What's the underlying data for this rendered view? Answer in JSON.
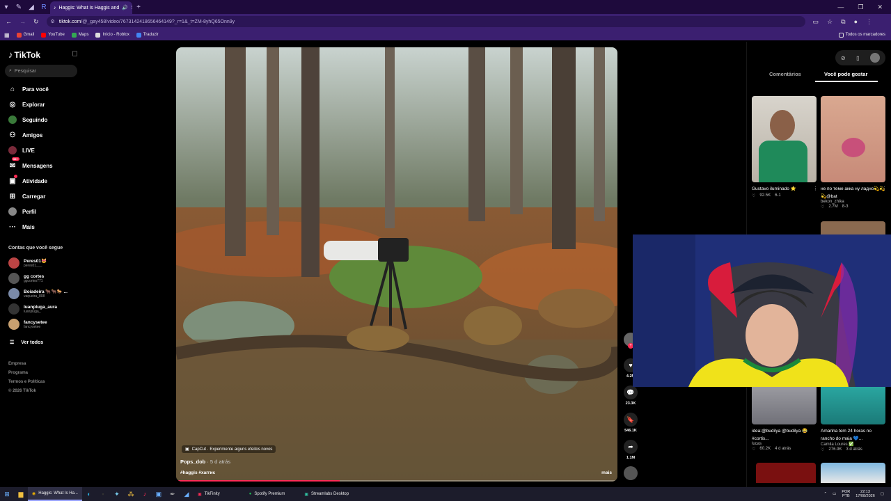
{
  "browser": {
    "tab_title": "Haggis: What Is Haggis and",
    "url_host": "tiktok.com",
    "url_path": "/@_gay458/video/7673142418656464149?_r=1&_t=ZM-8yhQ65Onn9y",
    "bookmarks": [
      "Gmail",
      "YouTube",
      "Maps",
      "Início - Roblox",
      "Traduzir"
    ],
    "all_bookmarks": "Todos os marcadores"
  },
  "sidebar": {
    "logo": "TikTok",
    "search_placeholder": "Pesquisar",
    "nav": [
      {
        "label": "Para você",
        "icon": "home-icon"
      },
      {
        "label": "Explorar",
        "icon": "compass-icon"
      },
      {
        "label": "Seguindo",
        "icon": "following-icon"
      },
      {
        "label": "Amigos",
        "icon": "friends-icon"
      },
      {
        "label": "LIVE",
        "icon": "live-icon"
      },
      {
        "label": "Mensagens",
        "icon": "message-icon",
        "badge": "99+"
      },
      {
        "label": "Atividade",
        "icon": "activity-icon"
      },
      {
        "label": "Carregar",
        "icon": "upload-icon"
      },
      {
        "label": "Perfil",
        "icon": "profile-icon"
      },
      {
        "label": "Mais",
        "icon": "more-icon"
      }
    ],
    "following_header": "Contas que você segue",
    "following": [
      {
        "name": "Peres01😻",
        "handle": "peres01___"
      },
      {
        "name": "gg cortes",
        "handle": "ggcortes771"
      },
      {
        "name": "Boiadeira 🐂🐂🐎 ...",
        "handle": "vaqueira_808"
      },
      {
        "name": "luanpluga_aura",
        "handle": "luanpluga_"
      },
      {
        "name": "fancysetee",
        "handle": "fancysetee"
      }
    ],
    "see_all": "Ver todos",
    "footer": [
      "Empresa",
      "Programa",
      "Termos e Políticas",
      "© 2026 TikTok"
    ]
  },
  "video": {
    "capcut": "CapCut · Experimente alguns efeitos novos",
    "author": "Pops_dob",
    "ago": " · 5 d atrás",
    "tags": "#haggis #хаггис",
    "more": "mais",
    "progress": 0.37,
    "likes": "4.2M",
    "comments": "23.3K",
    "saves": "546.1K",
    "shares": "1.1M"
  },
  "right": {
    "tab_comments": "Comentários",
    "tab_suggest": "Você pode gostar",
    "cards": [
      {
        "title": "Gustavo iluminado ⭐",
        "likes": "92.5K",
        "ago": "6-1"
      },
      {
        "title": "не по теме акка ну ладно💫💫💫@bat",
        "author": "bekon_zhika",
        "likes": "2.7M",
        "ago": "8-3"
      },
      {
        "title": "idea:@budilya @budilya 😂 #cortis...",
        "author": "lucas",
        "likes": "60.2K",
        "ago": "4 d atrás"
      },
      {
        "title": "Amanha tem 24 horas no rancho do maia 💙...",
        "author": "Camila Loures ✅",
        "likes": "276.9K",
        "ago": "3 d atrás"
      }
    ]
  },
  "taskbar": {
    "apps": [
      "Haggis: What Is Ha...",
      "TikFinity",
      "Spotify Premium",
      "Streamlabs Desktop"
    ],
    "lang": "POR",
    "layout": "PTB",
    "time": "22:13",
    "date": "17/08/2026"
  }
}
